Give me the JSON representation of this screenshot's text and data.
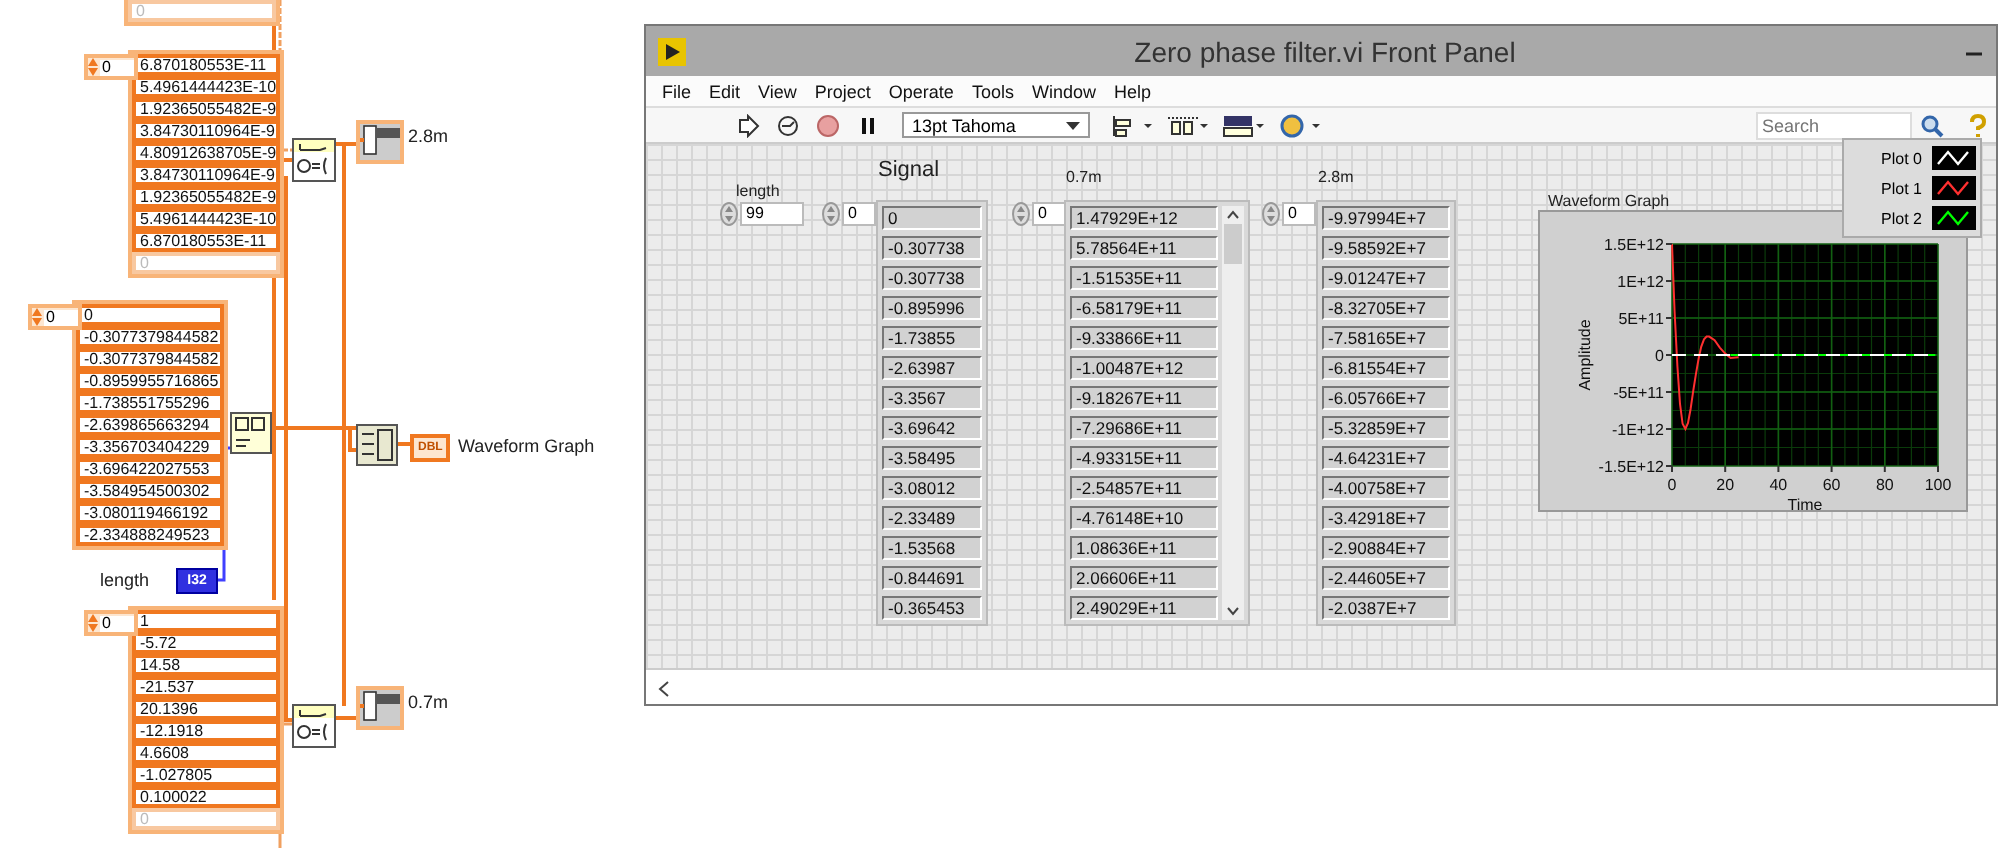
{
  "block_diagram": {
    "array_constants": [
      {
        "empty_element": "0"
      },
      {
        "index": "0",
        "elements": [
          "6.870180553E-11",
          "5.4961444423E-10",
          "1.92365055482E-9",
          "3.84730110964E-9",
          "4.80912638705E-9",
          "3.84730110964E-9",
          "1.92365055482E-9",
          "5.4961444423E-10",
          "6.870180553E-11"
        ],
        "empty_element": "0"
      },
      {
        "index": "0",
        "elements": [
          "0",
          "-0.3077379844582",
          "-0.3077379844582",
          "-0.8959955716865",
          "-1.738551755296",
          "-2.639865663294",
          "-3.356703404229",
          "-3.696422027553",
          "-3.584954500302",
          "-3.080119466192",
          "-2.334888249523"
        ]
      },
      {
        "index": "0",
        "elements": [
          "1",
          "-5.72",
          "14.58",
          "-21.537",
          "20.1396",
          "-12.1918",
          "4.6608",
          "-1.027805",
          "0.100022"
        ],
        "empty_element": "0"
      }
    ],
    "indicators": [
      {
        "label": "2.8m"
      },
      {
        "label": "0.7m"
      }
    ],
    "graph_terminal": {
      "type": "DBL",
      "label": "Waveform Graph"
    },
    "length_terminal": {
      "label": "length",
      "type": "I32"
    }
  },
  "front_panel": {
    "title": "Zero phase filter.vi Front Panel",
    "menu": [
      "File",
      "Edit",
      "View",
      "Project",
      "Operate",
      "Tools",
      "Window",
      "Help"
    ],
    "font_selector": "13pt Tahoma",
    "search": {
      "placeholder": "Search"
    },
    "length": {
      "label": "length",
      "value": "99"
    },
    "arrays": [
      {
        "label": "Signal",
        "index": "0",
        "scrollbar": false,
        "values": [
          "0",
          "-0.307738",
          "-0.307738",
          "-0.895996",
          "-1.73855",
          "-2.63987",
          "-3.3567",
          "-3.69642",
          "-3.58495",
          "-3.08012",
          "-2.33489",
          "-1.53568",
          "-0.844691",
          "-0.365453"
        ]
      },
      {
        "label": "0.7m",
        "index": "0",
        "scrollbar": true,
        "values": [
          "1.47929E+12",
          "5.78564E+11",
          "-1.51535E+11",
          "-6.58179E+11",
          "-9.33866E+11",
          "-1.00487E+12",
          "-9.18267E+11",
          "-7.29686E+11",
          "-4.93315E+11",
          "-2.54857E+11",
          "-4.76148E+10",
          "1.08636E+11",
          "2.06606E+11",
          "2.49029E+11"
        ]
      },
      {
        "label": "2.8m",
        "index": "0",
        "scrollbar": false,
        "values": [
          "-9.97994E+7",
          "-9.58592E+7",
          "-9.01247E+7",
          "-8.32705E+7",
          "-7.58165E+7",
          "-6.81554E+7",
          "-6.05766E+7",
          "-5.32859E+7",
          "-4.64231E+7",
          "-4.00758E+7",
          "-3.42918E+7",
          "-2.90884E+7",
          "-2.44605E+7",
          "-2.0387E+7"
        ]
      }
    ],
    "graph": {
      "title": "Waveform Graph",
      "chart_data": {
        "type": "line",
        "xlabel": "Time",
        "ylabel": "Amplitude",
        "x": [
          0,
          1,
          2,
          3,
          4,
          5,
          6,
          7,
          8,
          9,
          10,
          11,
          12,
          13,
          14,
          16,
          18,
          20,
          22,
          25,
          30,
          40,
          60,
          80,
          99
        ],
        "series": [
          {
            "name": "Plot 0",
            "color": "#ffffff",
            "line_style": "dashed",
            "values": [
              0,
              0,
              0,
              0,
              0,
              0,
              0,
              0,
              0,
              0,
              0,
              0,
              0,
              0,
              0,
              0,
              0,
              0,
              0,
              0,
              0,
              0,
              0,
              0,
              0
            ]
          },
          {
            "name": "Plot 1",
            "color": "#ff3030",
            "values": [
              1500000000000.0,
              580000000000.0,
              -150000000000.0,
              -660000000000.0,
              -930000000000.0,
              -1000000000000.0,
              -920000000000.0,
              -730000000000.0,
              -490000000000.0,
              -250000000000.0,
              -50000000000.0,
              110000000000.0,
              210000000000.0,
              250000000000.0,
              250000000000.0,
              200000000000.0,
              100000000000.0,
              20000000000.0,
              -40000000000.0,
              -30000000000.0,
              null,
              null,
              null,
              null,
              null
            ]
          },
          {
            "name": "Plot 2",
            "color": "#00ff00",
            "values": [
              null,
              null,
              null,
              null,
              null,
              null,
              null,
              null,
              null,
              null,
              null,
              null,
              null,
              null,
              null,
              null,
              null,
              null,
              0,
              0,
              0,
              0,
              0,
              0,
              0
            ]
          }
        ],
        "grid": true,
        "xlim": [
          0,
          100
        ],
        "ylim": [
          -1500000000000.0,
          1500000000000.0
        ],
        "xticks": [
          0,
          20,
          40,
          60,
          80,
          100
        ],
        "yticks": [
          {
            "value": 1500000000000.0,
            "label": "1.5E+12"
          },
          {
            "value": 1000000000000.0,
            "label": "1E+12"
          },
          {
            "value": 500000000000.0,
            "label": "5E+11"
          },
          {
            "value": 0,
            "label": "0"
          },
          {
            "value": -500000000000.0,
            "label": "-5E+11"
          },
          {
            "value": -1000000000000.0,
            "label": "-1E+12"
          },
          {
            "value": -1500000000000.0,
            "label": "-1.5E+12"
          }
        ]
      }
    }
  }
}
